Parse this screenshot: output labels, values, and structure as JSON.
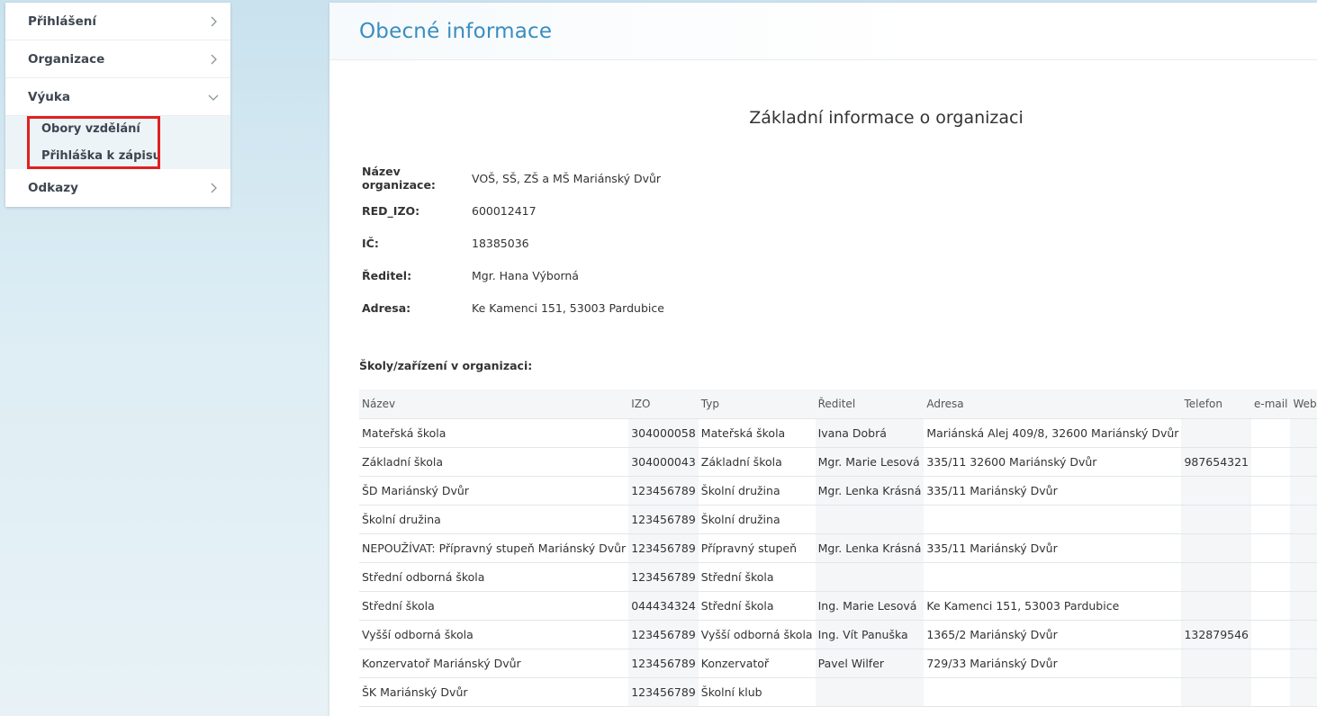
{
  "sidebar": {
    "items": [
      {
        "label": "Přihlášení",
        "expanded": false
      },
      {
        "label": "Organizace",
        "expanded": false
      },
      {
        "label": "Výuka",
        "expanded": true
      },
      {
        "label": "Odkazy",
        "expanded": false
      }
    ],
    "submenu": [
      {
        "label": "Obory vzdělání"
      },
      {
        "label": "Přihláška k zápisu"
      }
    ],
    "highlight_color": "#e02020"
  },
  "main": {
    "title": "Obecné informace",
    "section_title": "Základní informace o organizaci",
    "info": {
      "name_label": "Název organizace:",
      "name_value": "VOŠ, SŠ, ZŠ a MŠ Mariánský Dvůr",
      "redizo_label": "RED_IZO:",
      "redizo_value": "600012417",
      "ic_label": "IČ:",
      "ic_value": "18385036",
      "director_label": "Ředitel:",
      "director_value": "Mgr. Hana Výborná",
      "address_label": "Adresa:",
      "address_value": "Ke Kamenci 151, 53003 Pardubice"
    },
    "schools_title": "Školy/zařízení v organizaci:",
    "schools_table": {
      "headers": [
        "Název",
        "IZO",
        "Typ",
        "Ředitel",
        "Adresa",
        "Telefon",
        "e-mail",
        "Webové stránky"
      ],
      "rows": [
        [
          "Mateřská škola",
          "304000058",
          "Mateřská škola",
          "Ivana Dobrá",
          "Mariánská Alej 409/8, 32600 Mariánský Dvůr",
          "",
          "",
          ""
        ],
        [
          "Základní škola",
          "304000043",
          "Základní škola",
          "Mgr. Marie Lesová",
          "335/11 32600 Mariánský Dvůr",
          "987654321",
          "",
          ""
        ],
        [
          "ŠD Mariánský Dvůr",
          "123456789",
          "Školní družina",
          "Mgr. Lenka Krásná",
          "335/11 Mariánský Dvůr",
          "",
          "",
          ""
        ],
        [
          "Školní družina",
          "123456789",
          "Školní družina",
          "",
          "",
          "",
          "",
          ""
        ],
        [
          "NEPOUŽÍVAT: Přípravný stupeň Mariánský Dvůr",
          "123456789",
          "Přípravný stupeň",
          "Mgr. Lenka Krásná",
          "335/11 Mariánský Dvůr",
          "",
          "",
          ""
        ],
        [
          "Střední odborná škola",
          "123456789",
          "Střední škola",
          "",
          "",
          "",
          "",
          ""
        ],
        [
          "Střední škola",
          "044434324",
          "Střední škola",
          "Ing. Marie Lesová",
          "Ke Kamenci 151, 53003 Pardubice",
          "",
          "",
          ""
        ],
        [
          "Vyšší odborná škola",
          "123456789",
          "Vyšší odborná škola",
          "Ing. Vít Panuška",
          "1365/2 Mariánský Dvůr",
          "132879546",
          "",
          ""
        ],
        [
          "Konzervatoř Mariánský Dvůr",
          "123456789",
          "Konzervatoř",
          "Pavel Wilfer",
          "729/33 Mariánský Dvůr",
          "",
          "",
          ""
        ],
        [
          "ŠK Mariánský Dvůr",
          "123456789",
          "Školní klub",
          "",
          "",
          "",
          "",
          ""
        ]
      ]
    }
  }
}
